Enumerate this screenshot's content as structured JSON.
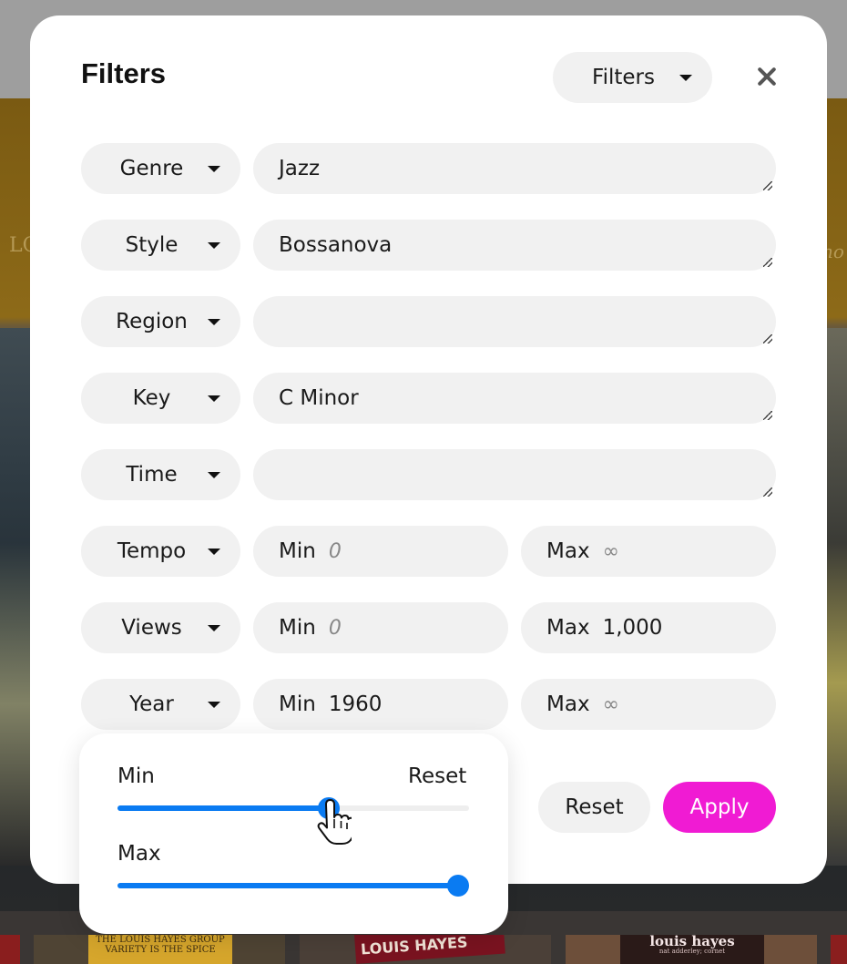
{
  "modal": {
    "title": "Filters",
    "header_select": "Filters"
  },
  "fields": [
    {
      "name": "Genre",
      "value": "Jazz"
    },
    {
      "name": "Style",
      "value": "Bossanova"
    },
    {
      "name": "Region",
      "value": ""
    },
    {
      "name": "Key",
      "value": "C Minor"
    },
    {
      "name": "Time",
      "value": ""
    }
  ],
  "ranges": [
    {
      "name": "Tempo",
      "min_label": "Min",
      "min_value": "0",
      "min_is_placeholder": true,
      "max_label": "Max",
      "max_value": "∞",
      "max_is_placeholder": true
    },
    {
      "name": "Views",
      "min_label": "Min",
      "min_value": "0",
      "min_is_placeholder": true,
      "max_label": "Max",
      "max_value": "1,000",
      "max_is_placeholder": false
    },
    {
      "name": "Year",
      "min_label": "Min",
      "min_value": "1960",
      "min_is_placeholder": false,
      "max_label": "Max",
      "max_value": "∞",
      "max_is_placeholder": true
    }
  ],
  "buttons": {
    "reset": "Reset",
    "apply": "Apply"
  },
  "colors": {
    "accent": "#0a7bf2",
    "apply": "#f01bd3"
  },
  "popover": {
    "min_label": "Min",
    "reset_label": "Reset",
    "max_label": "Max",
    "min_slider_fraction": 0.6,
    "max_slider_fraction": 0.97
  },
  "background": {
    "left_text": "LO",
    "right_text": "no",
    "album_1": "THE LOUIS HAYES GROUP VARIETY IS THE SPICE",
    "album_2": "LOUIS HAYES",
    "album_3": "louis hayes",
    "album_3_sub": "nat adderley; cornet"
  }
}
